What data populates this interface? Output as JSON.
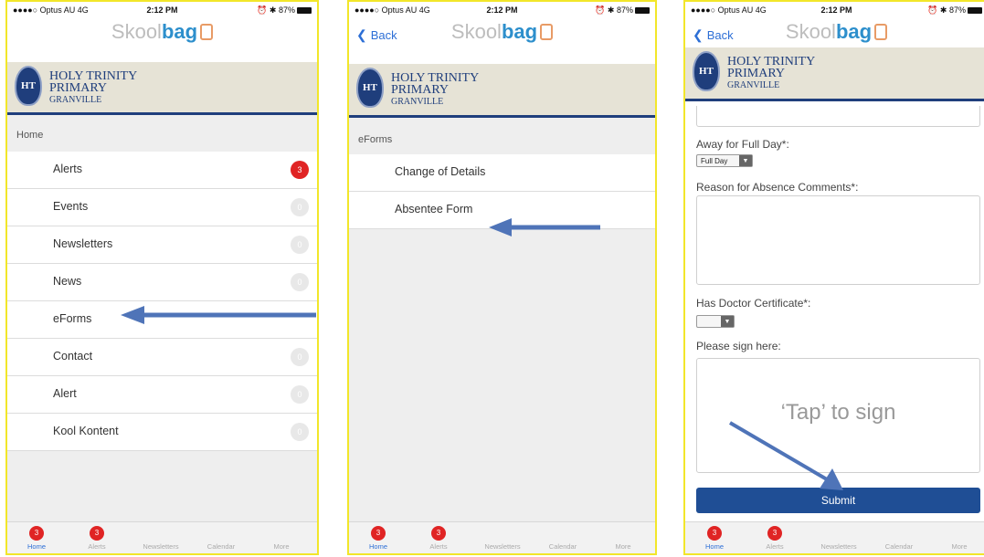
{
  "status": {
    "carrier": "●●●●○ Optus AU  4G",
    "time": "2:12 PM",
    "battery": "87%"
  },
  "app": {
    "logo_light": "Skool",
    "logo_bold": "bag"
  },
  "school": {
    "line1": "HOLY TRINITY",
    "line2": "PRIMARY",
    "line3": "GRANVILLE",
    "crest": "HT"
  },
  "screen1": {
    "section": "Home",
    "items": [
      {
        "label": "Alerts",
        "badge": "3",
        "badge_color": "#e02424"
      },
      {
        "label": "Events",
        "badge": "0"
      },
      {
        "label": "Newsletters",
        "badge": "0"
      },
      {
        "label": "News",
        "badge": "0"
      },
      {
        "label": "eForms",
        "badge": ""
      },
      {
        "label": "Contact",
        "badge": "0"
      },
      {
        "label": "Alert",
        "badge": "0"
      },
      {
        "label": "Kool Kontent",
        "badge": "0"
      }
    ]
  },
  "screen2": {
    "back": "Back",
    "section": "eForms",
    "items": [
      {
        "label": "Change of Details"
      },
      {
        "label": "Absentee Form"
      }
    ]
  },
  "screen3": {
    "back": "Back",
    "away_label": "Away for Full Day*:",
    "away_value": "Full Day",
    "reason_label": "Reason for Absence Comments*:",
    "doctor_label": "Has Doctor Certificate*:",
    "doctor_value": "",
    "sign_label": "Please sign here:",
    "tap_text": "‘Tap’ to sign",
    "submit": "Submit"
  },
  "tabbar": {
    "tabs": [
      {
        "label": "Home",
        "badge": "3"
      },
      {
        "label": "Alerts",
        "badge": "3"
      },
      {
        "label": "Newsletters"
      },
      {
        "label": "Calendar"
      },
      {
        "label": "More"
      }
    ],
    "active": "Home"
  },
  "colors": {
    "accent": "#2d6fd6",
    "brand_navy": "#1f3e7c",
    "badge_red": "#e02424",
    "highlight_border": "#f2e62a",
    "submit": "#1f4e95"
  },
  "icons": [
    "back-chevron-icon",
    "battery-icon",
    "alarm-icon",
    "bluetooth-icon",
    "dropdown-arrow-icon",
    "arrow-annotation-icon"
  ]
}
